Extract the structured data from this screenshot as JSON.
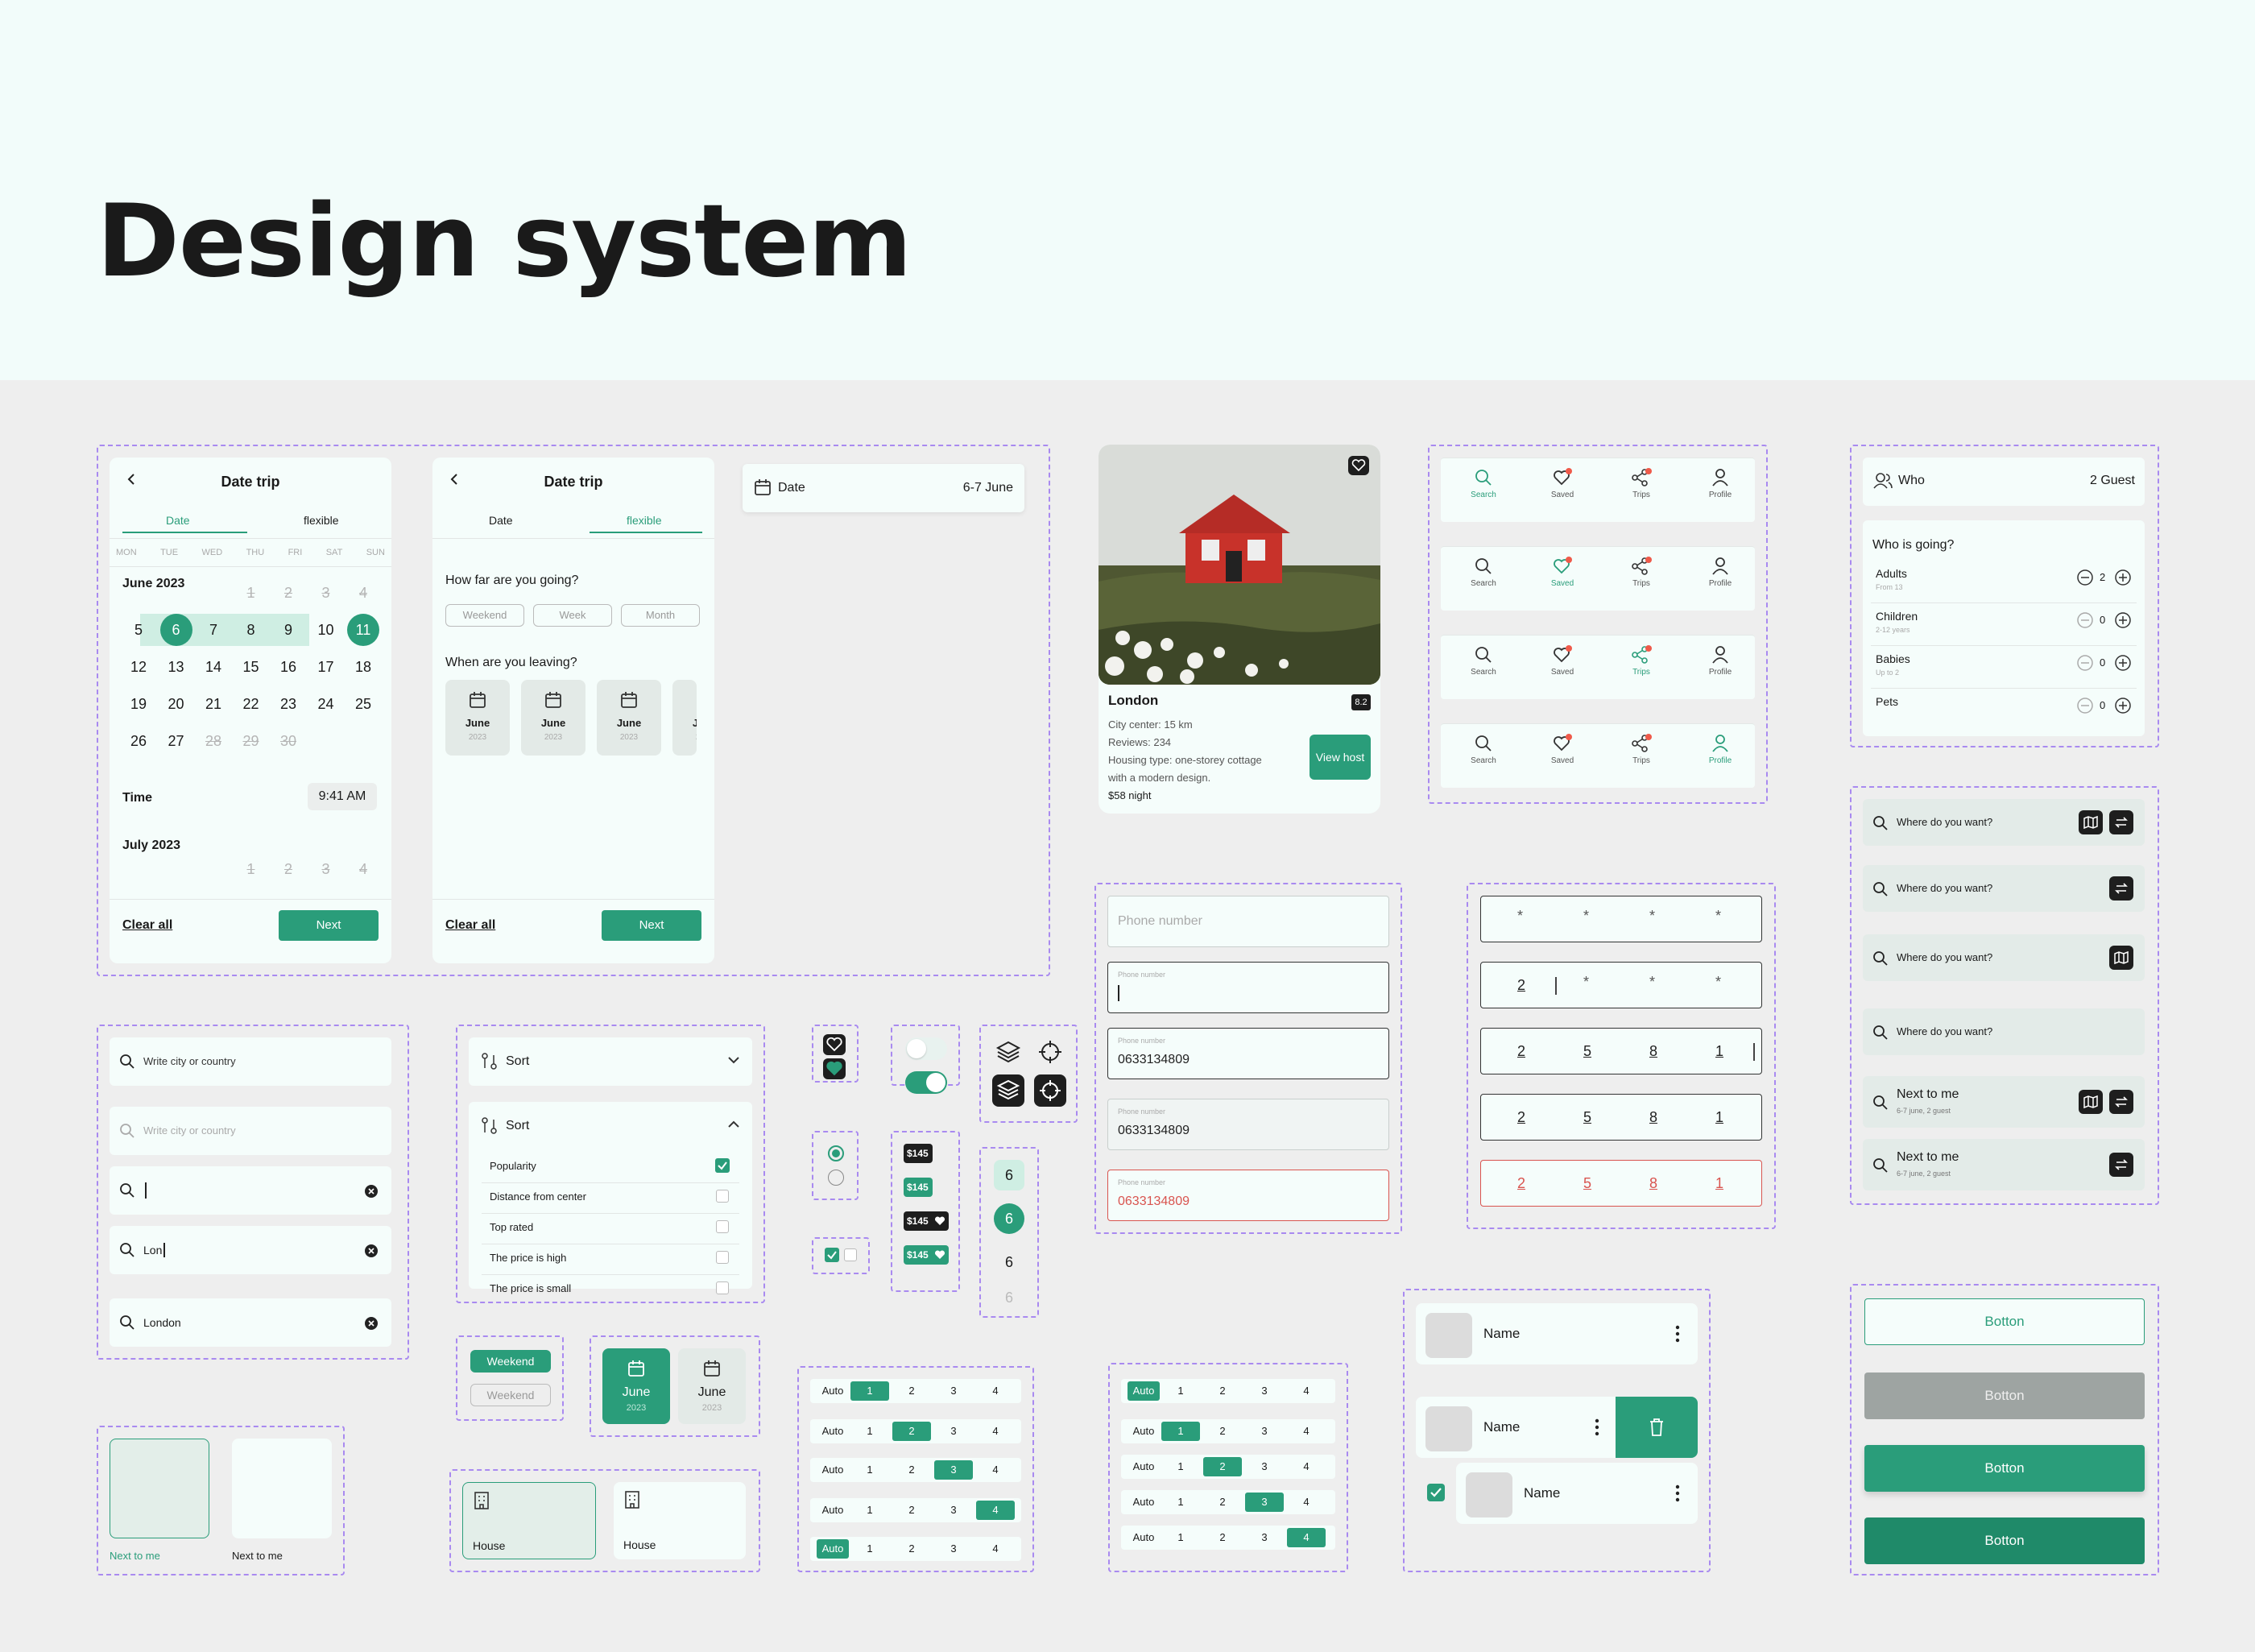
{
  "page_title": "Design system",
  "date_trip": {
    "title": "Date trip",
    "tab_date": "Date",
    "tab_flexible": "flexible",
    "weekdays": [
      "MON",
      "TUE",
      "WED",
      "THU",
      "FRI",
      "SAT",
      "SUN"
    ],
    "month1": "June 2023",
    "month2": "July 2023",
    "time_label": "Time",
    "time_value": "9:41 AM",
    "clear": "Clear all",
    "next": "Next",
    "june_rows": [
      [
        "",
        "",
        "",
        "1",
        "2",
        "3",
        "4"
      ],
      [
        "5",
        "6",
        "7",
        "8",
        "9",
        "10",
        "11"
      ],
      [
        "12",
        "13",
        "14",
        "15",
        "16",
        "17",
        "18"
      ],
      [
        "19",
        "20",
        "21",
        "22",
        "23",
        "24",
        "25"
      ],
      [
        "26",
        "27",
        "28",
        "29",
        "30",
        "",
        ""
      ]
    ],
    "july_row": [
      "",
      "",
      "",
      "1",
      "2",
      "3",
      "4"
    ]
  },
  "flexible": {
    "title": "Date trip",
    "tab_date": "Date",
    "tab_flexible": "flexible",
    "question1": "How far are you going?",
    "opts": [
      "Weekend",
      "Week",
      "Month"
    ],
    "question2": "When are you leaving?",
    "month": "June",
    "year": "2023",
    "clear": "Clear all",
    "next": "Next"
  },
  "date_field": {
    "label": "Date",
    "value": "6-7 June"
  },
  "listing": {
    "city": "London",
    "rating": "8.2",
    "line1": "City center: 15 km",
    "line2": "Reviews: 234",
    "line3": "Housing type: one-storey cottage",
    "line4": "with a modern design.",
    "price": "$58 night",
    "button": "View host"
  },
  "tabbar": {
    "items": [
      "Search",
      "Saved",
      "Trips",
      "Profile"
    ]
  },
  "who": {
    "label": "Who",
    "value": "2 Guest",
    "heading": "Who is going?",
    "rows": [
      {
        "name": "Adults",
        "sub": "From 13",
        "count": "2"
      },
      {
        "name": "Children",
        "sub": "2-12 years",
        "count": "0"
      },
      {
        "name": "Babies",
        "sub": "Up to 2",
        "count": "0"
      },
      {
        "name": "Pets",
        "sub": "",
        "count": "0"
      }
    ]
  },
  "where": {
    "placeholder": "Where do you want?",
    "next_title": "Next to me",
    "next_sub": "6-7 june, 2 guest"
  },
  "phone": {
    "placeholder": "Phone number",
    "label": "Phone number",
    "value": "0633134809"
  },
  "pin": {
    "star": "*",
    "digits": [
      "2",
      "5",
      "8",
      "1"
    ]
  },
  "search": {
    "placeholder": "Write city or country",
    "partial": "Lon",
    "full": "London"
  },
  "sort": {
    "label": "Sort",
    "options": [
      "Popularity",
      "Distance from center",
      "Top rated",
      "The price is high",
      "The price is small"
    ]
  },
  "price": {
    "value": "$145"
  },
  "stepper_num": "6",
  "chips": {
    "weekend": "Weekend",
    "month": "June",
    "year": "2023"
  },
  "house": {
    "label": "House"
  },
  "next_to_me": {
    "label": "Next to me"
  },
  "seg": {
    "auto": "Auto",
    "nums": [
      "1",
      "2",
      "3",
      "4"
    ]
  },
  "name_rows": {
    "label": "Name"
  },
  "buttons": {
    "label": "Botton"
  },
  "colors": {
    "teal": "#2a9d7a",
    "dark_teal": "#1f8a69",
    "mint": "#cfeee3",
    "error": "#d9544f"
  }
}
